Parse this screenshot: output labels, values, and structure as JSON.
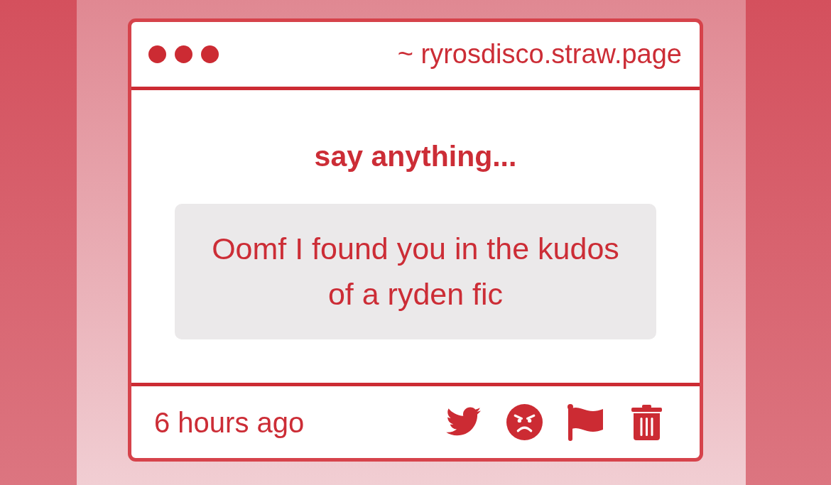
{
  "header": {
    "url": "~ ryrosdisco.straw.page"
  },
  "prompt": "say anything...",
  "message": "Oomf I found you in the kudos of a ryden fic",
  "footer": {
    "time": "6 hours ago",
    "actions": [
      {
        "kind": "twitter"
      },
      {
        "kind": "angry"
      },
      {
        "kind": "flag"
      },
      {
        "kind": "trash"
      }
    ]
  }
}
